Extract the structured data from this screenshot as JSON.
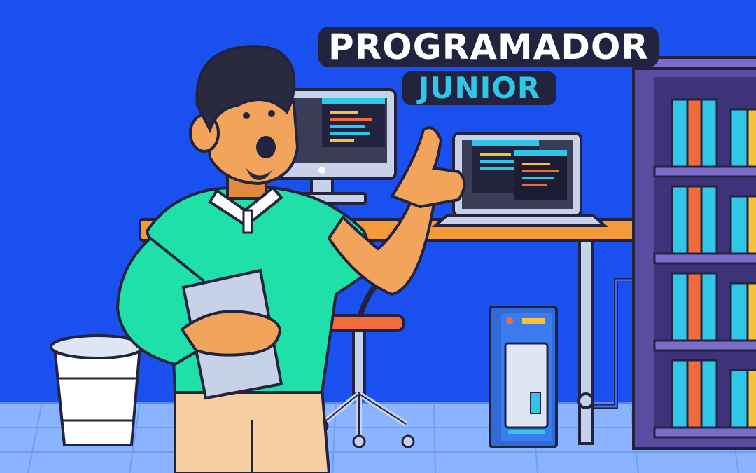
{
  "title": {
    "line1": "PROGRAMADOR",
    "line2": "JUNIOR"
  },
  "colors": {
    "background": "#1a4ff0",
    "floor": "#8ab4ff",
    "accent_cyan": "#2fc6e8",
    "shirt": "#1fe0a8",
    "skin": "#f2a45c",
    "hair": "#2a2a3e",
    "desk": "#f59a38",
    "shelf": "#5a4ca0"
  },
  "icons": [
    "monitor-icon",
    "laptop-icon",
    "computer-tower-icon",
    "bookshelf-icon",
    "trash-bin-icon",
    "office-chair-icon",
    "tablet-icon"
  ]
}
